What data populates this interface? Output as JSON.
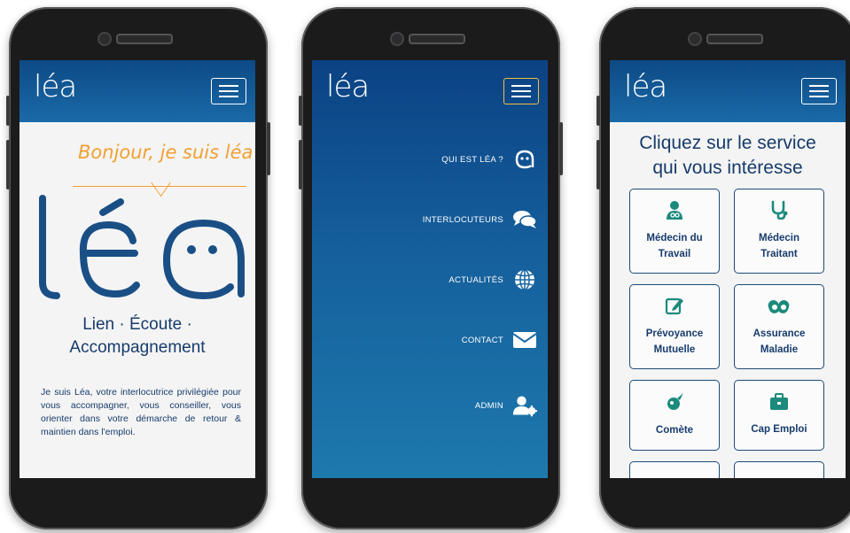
{
  "phones": [
    {
      "logo": "léa",
      "greeting": "Bonjour, je suis léa",
      "tagline_line1": "Lien · Écoute ·",
      "tagline_line2": "Accompagnement",
      "intro": "Je suis Léa, votre interlocutrice privilégiée pour vous accompagner, vous conseiller, vous orienter dans votre démarche de retour & maintien dans l'emploi."
    },
    {
      "menu": [
        {
          "label": "QUI EST LÉA ?",
          "icon": "lea-face-icon"
        },
        {
          "label": "INTERLOCUTEURS",
          "icon": "chat-bubbles-icon"
        },
        {
          "label": "ACTUALITÉS",
          "icon": "globe-icon"
        },
        {
          "label": "CONTACT",
          "icon": "envelope-icon"
        },
        {
          "label": "ADMIN",
          "icon": "user-gear-icon"
        }
      ]
    },
    {
      "logo": "léa",
      "title_line1": "Cliquez sur le service",
      "title_line2": "qui vous intéresse",
      "services": [
        {
          "label_line1": "Médecin du",
          "label_line2": "Travail",
          "icon": "doctor-icon"
        },
        {
          "label_line1": "Médecin",
          "label_line2": "Traitant",
          "icon": "stethoscope-icon"
        },
        {
          "label_line1": "Prévoyance",
          "label_line2": "Mutuelle",
          "icon": "edit-icon"
        },
        {
          "label_line1": "Assurance",
          "label_line2": "Maladie",
          "icon": "pills-icon"
        },
        {
          "label_line1": "Comète",
          "label_line2": "",
          "icon": "comet-icon"
        },
        {
          "label_line1": "Cap Emploi",
          "label_line2": "",
          "icon": "briefcase-icon"
        }
      ]
    }
  ],
  "colors": {
    "header": "#0d4a85",
    "navy_text": "#173b6c",
    "accent_orange": "#f0a033",
    "teal_icon": "#1c8a7c",
    "active_burger": "#f0c040"
  }
}
